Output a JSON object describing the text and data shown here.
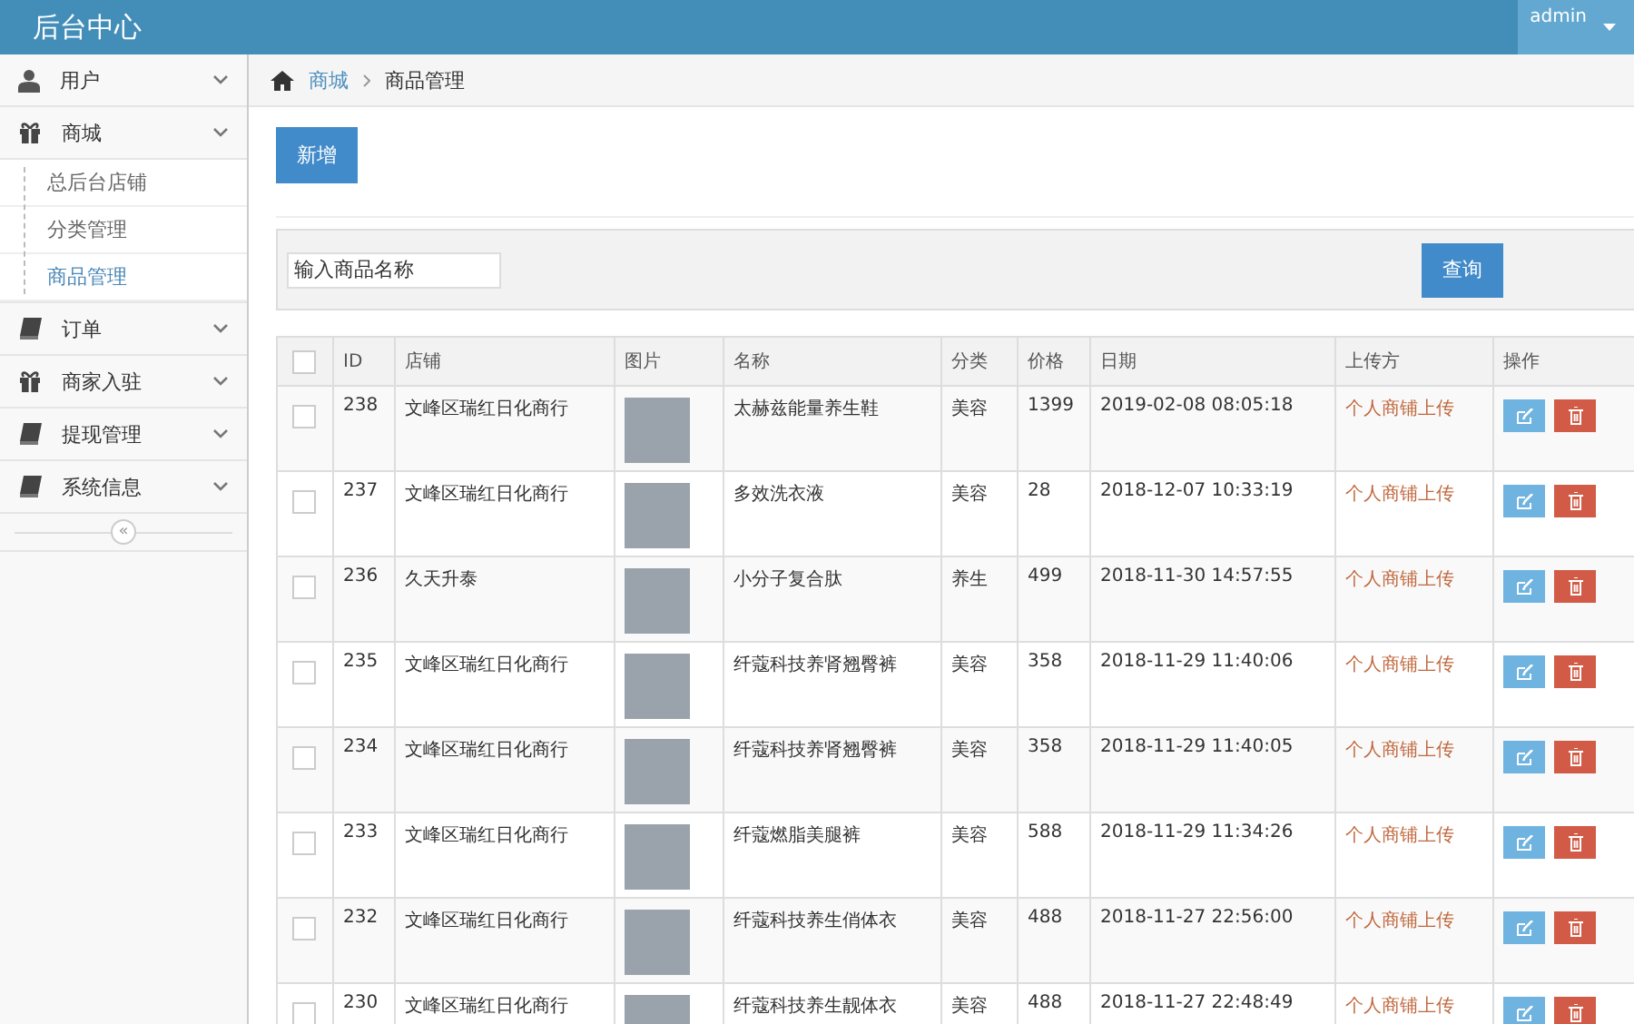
{
  "app": {
    "title": "后台中心",
    "user": "admin"
  },
  "sidebar": {
    "items": [
      {
        "label": "用户",
        "kind": "user"
      },
      {
        "label": "商城",
        "kind": "gift",
        "children": [
          {
            "label": "总后台店铺",
            "selected": false
          },
          {
            "label": "分类管理",
            "selected": false
          },
          {
            "label": "商品管理",
            "selected": true
          }
        ]
      },
      {
        "label": "订单",
        "kind": "book"
      },
      {
        "label": "商家入驻",
        "kind": "gift"
      },
      {
        "label": "提现管理",
        "kind": "book"
      },
      {
        "label": "系统信息",
        "kind": "book"
      }
    ],
    "collapse_symbol": "«"
  },
  "breadcrumb": [
    "商城",
    "商品管理"
  ],
  "add_button": "新增",
  "search": {
    "placeholder": "输入商品名称",
    "button": "查询"
  },
  "table": {
    "header_checked": false,
    "columns": [
      "ID",
      "店铺",
      "图片",
      "名称",
      "分类",
      "价格",
      "日期",
      "上传方",
      "操作"
    ],
    "rows": [
      {
        "checked": false,
        "id": "238",
        "shop": "文峰区瑞红日化商行",
        "name": "太赫兹能量养生鞋",
        "category": "美容",
        "price": "1399",
        "date": "2019-02-08 08:05:18",
        "uploader": "个人商铺上传"
      },
      {
        "checked": false,
        "id": "237",
        "shop": "文峰区瑞红日化商行",
        "name": "多效洗衣液",
        "category": "美容",
        "price": "28",
        "date": "2018-12-07 10:33:19",
        "uploader": "个人商铺上传"
      },
      {
        "checked": false,
        "id": "236",
        "shop": "久天升泰",
        "name": "小分子复合肽",
        "category": "养生",
        "price": "499",
        "date": "2018-11-30 14:57:55",
        "uploader": "个人商铺上传"
      },
      {
        "checked": false,
        "id": "235",
        "shop": "文峰区瑞红日化商行",
        "name": "纤蔻科技养肾翘臀裤",
        "category": "美容",
        "price": "358",
        "date": "2018-11-29 11:40:06",
        "uploader": "个人商铺上传"
      },
      {
        "checked": false,
        "id": "234",
        "shop": "文峰区瑞红日化商行",
        "name": "纤蔻科技养肾翘臀裤",
        "category": "美容",
        "price": "358",
        "date": "2018-11-29 11:40:05",
        "uploader": "个人商铺上传"
      },
      {
        "checked": false,
        "id": "233",
        "shop": "文峰区瑞红日化商行",
        "name": "纤蔻燃脂美腿裤",
        "category": "美容",
        "price": "588",
        "date": "2018-11-29 11:34:26",
        "uploader": "个人商铺上传"
      },
      {
        "checked": false,
        "id": "232",
        "shop": "文峰区瑞红日化商行",
        "name": "纤蔻科技养生俏体衣",
        "category": "美容",
        "price": "488",
        "date": "2018-11-27 22:56:00",
        "uploader": "个人商铺上传"
      },
      {
        "checked": false,
        "id": "230",
        "shop": "文峰区瑞红日化商行",
        "name": "纤蔻科技养生靓体衣",
        "category": "美容",
        "price": "488",
        "date": "2018-11-27 22:48:49",
        "uploader": "个人商铺上传"
      }
    ]
  }
}
